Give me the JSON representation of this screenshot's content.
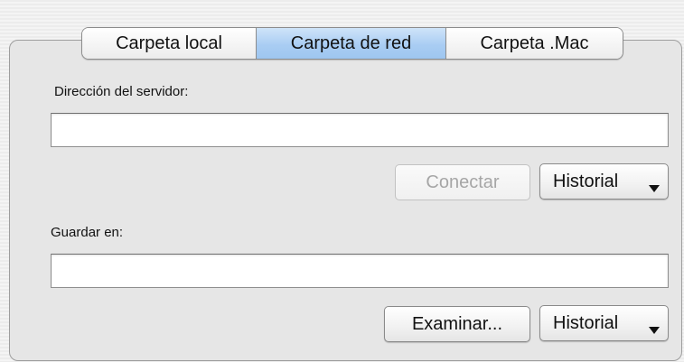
{
  "tabs": [
    {
      "label": "Carpeta local",
      "selected": false
    },
    {
      "label": "Carpeta de red",
      "selected": true
    },
    {
      "label": "Carpeta .Mac",
      "selected": false
    }
  ],
  "server": {
    "label": "Dirección del servidor:",
    "value": "",
    "connect_label": "Conectar",
    "connect_enabled": false,
    "history_label": "Historial"
  },
  "save": {
    "label": "Guardar en:",
    "value": "",
    "browse_label": "Examinar...",
    "history_label": "Historial"
  },
  "colors": {
    "selected_tab": "#a9cdf3",
    "disabled_text": "#a6a6a6"
  }
}
